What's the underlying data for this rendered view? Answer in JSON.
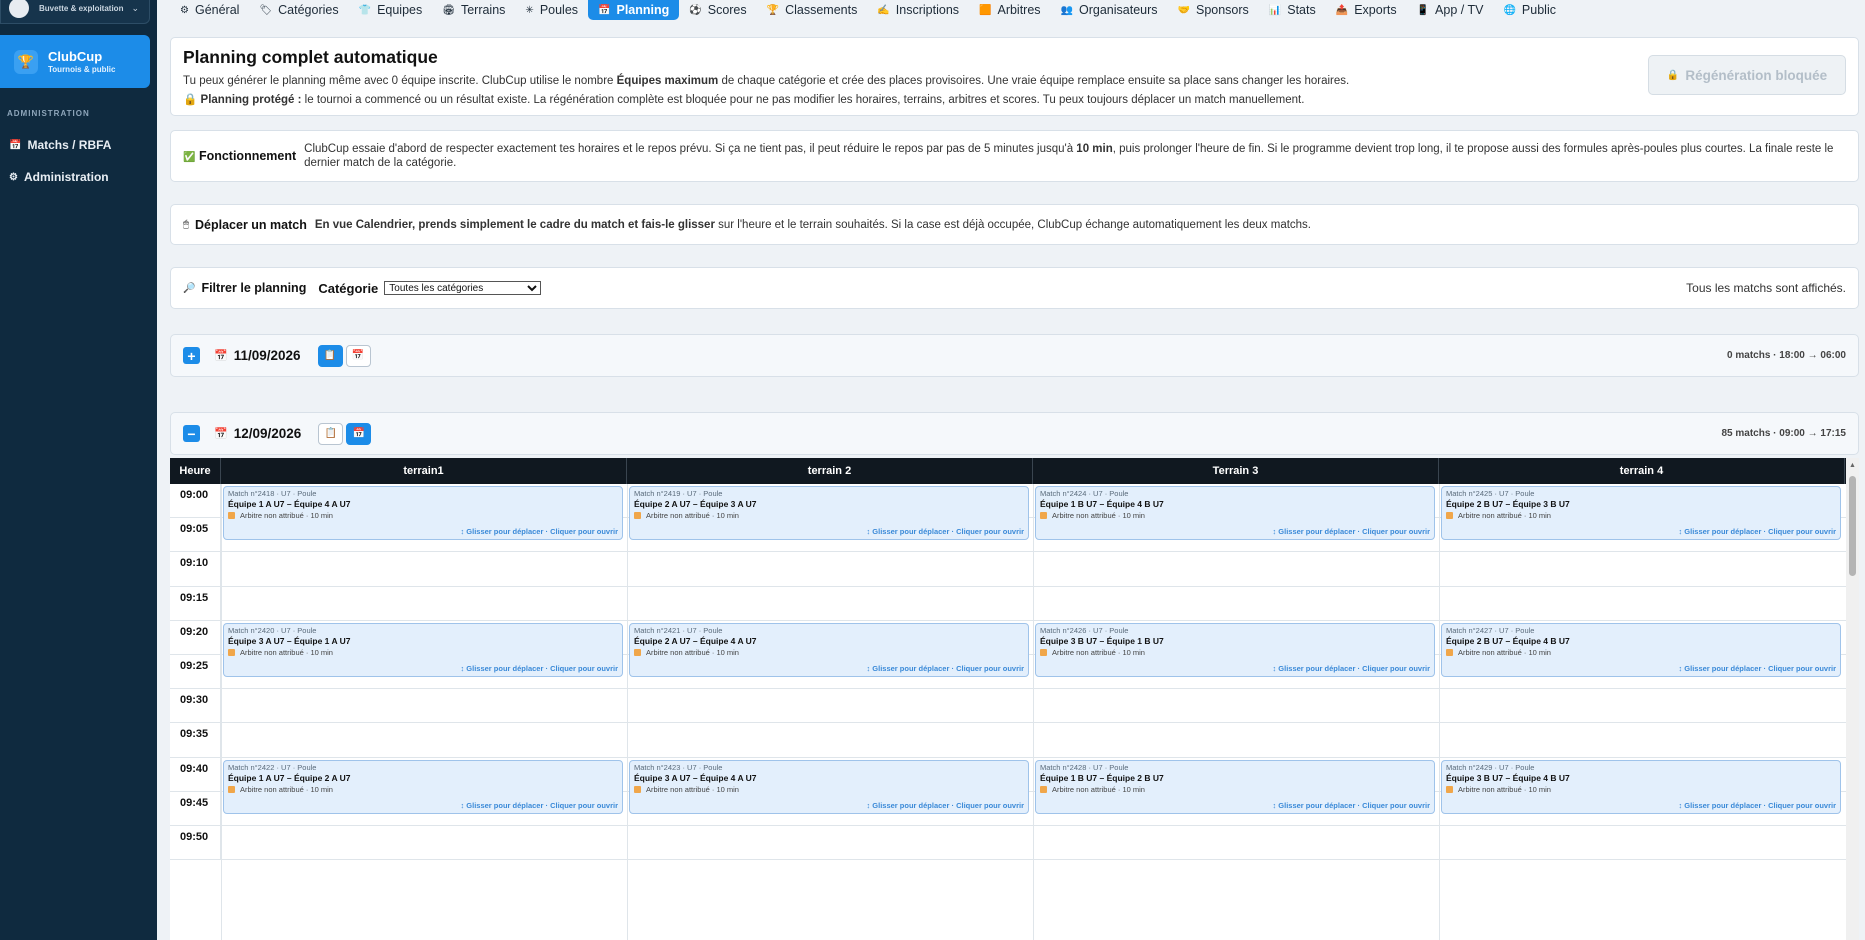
{
  "sidebar": {
    "top_label": "Buvette & exploitation",
    "brand_name": "ClubCup",
    "brand_sub": "Tournois & public",
    "section_label": "ADMINISTRATION",
    "items": [
      {
        "label": "Matchs / RBFA",
        "icon": "calendar-icon"
      },
      {
        "label": "Administration",
        "icon": "gear-icon"
      }
    ]
  },
  "nav": {
    "items": [
      {
        "label": "Général",
        "icon": "gear-icon"
      },
      {
        "label": "Catégories",
        "icon": "tag-icon"
      },
      {
        "label": "Equipes",
        "icon": "shirt-icon"
      },
      {
        "label": "Terrains",
        "icon": "stadium-icon"
      },
      {
        "label": "Poules",
        "icon": "cluster-icon"
      },
      {
        "label": "Planning",
        "icon": "calendar-icon"
      },
      {
        "label": "Scores",
        "icon": "ball-icon"
      },
      {
        "label": "Classements",
        "icon": "trophy-icon"
      },
      {
        "label": "Inscriptions",
        "icon": "pen-icon"
      },
      {
        "label": "Arbitres",
        "icon": "card-icon"
      },
      {
        "label": "Organisateurs",
        "icon": "people-icon"
      },
      {
        "label": "Sponsors",
        "icon": "handshake-icon"
      },
      {
        "label": "Stats",
        "icon": "chart-icon"
      },
      {
        "label": "Exports",
        "icon": "export-icon"
      },
      {
        "label": "App / TV",
        "icon": "phone-icon"
      },
      {
        "label": "Public",
        "icon": "globe-icon"
      }
    ],
    "active": "Planning"
  },
  "general": {
    "title": "Planning complet automatique",
    "line1_a": "Tu peux générer le planning même avec 0 équipe inscrite. ClubCup utilise le nombre ",
    "line1_b": "Équipes maximum",
    "line1_c": " de chaque catégorie et crée des places provisoires. Une vraie équipe remplace ensuite sa place sans changer les horaires.",
    "line2_a": "Planning protégé :",
    "line2_b": " le tournoi a commencé ou un résultat existe. La régénération complète est bloquée pour ne pas modifier les horaires, terrains, arbitres et scores. Tu peux toujours déplacer un match manuellement.",
    "regen_button": "Régénération bloquée"
  },
  "fonctionnement": {
    "label": "Fonctionnement",
    "text_a": "ClubCup essaie d'abord de respecter exactement tes horaires et le repos prévu. Si ça ne tient pas, il peut réduire le repos par pas de 5 minutes jusqu'à ",
    "text_b": "10 min",
    "text_c": ", puis prolonger l'heure de fin. Si le programme devient trop long, il te propose aussi des formules après-poules plus courtes. La finale reste le dernier match de la catégorie."
  },
  "deplacer": {
    "label": "Déplacer un match",
    "text_a": "En vue Calendrier, prends simplement le cadre du match et fais-le glisser",
    "text_b": " sur l'heure et le terrain souhaités. Si la case est déjà occupée, ClubCup échange automatiquement les deux matchs."
  },
  "filter": {
    "label": "Filtrer le planning",
    "category_label": "Catégorie",
    "category_value": "Toutes les catégories",
    "status": "Tous les matchs sont affichés."
  },
  "days": [
    {
      "date": "11/09/2026",
      "info": "0 matchs · 18:00 → 06:00",
      "expanded": false
    },
    {
      "date": "12/09/2026",
      "info": "85 matchs · 09:00 → 17:15",
      "expanded": true
    }
  ],
  "grid": {
    "time_header": "Heure",
    "terrains": [
      "terrain1",
      "terrain 2",
      "Terrain 3",
      "terrain 4"
    ],
    "times": [
      "09:00",
      "09:05",
      "09:10",
      "09:15",
      "09:20",
      "09:25",
      "09:30",
      "09:35",
      "09:40",
      "09:45",
      "09:50"
    ],
    "ref_text": "Arbitre non attribué · 10 min",
    "hint_text": "↕ Glisser pour déplacer · Cliquer pour ouvrir",
    "matches": [
      {
        "slot": 0,
        "col": 0,
        "meta": "Match n°2418 · U7 · Poule",
        "teams": "Équipe 1 A U7 – Équipe 4 A U7"
      },
      {
        "slot": 0,
        "col": 1,
        "meta": "Match n°2419 · U7 · Poule",
        "teams": "Équipe 2 A U7 – Équipe 3 A U7"
      },
      {
        "slot": 0,
        "col": 2,
        "meta": "Match n°2424 · U7 · Poule",
        "teams": "Équipe 1 B U7 – Équipe 4 B U7"
      },
      {
        "slot": 0,
        "col": 3,
        "meta": "Match n°2425 · U7 · Poule",
        "teams": "Équipe 2 B U7 – Équipe 3 B U7"
      },
      {
        "slot": 4,
        "col": 0,
        "meta": "Match n°2420 · U7 · Poule",
        "teams": "Équipe 3 A U7 – Équipe 1 A U7"
      },
      {
        "slot": 4,
        "col": 1,
        "meta": "Match n°2421 · U7 · Poule",
        "teams": "Équipe 2 A U7 – Équipe 4 A U7"
      },
      {
        "slot": 4,
        "col": 2,
        "meta": "Match n°2426 · U7 · Poule",
        "teams": "Équipe 3 B U7 – Équipe 1 B U7"
      },
      {
        "slot": 4,
        "col": 3,
        "meta": "Match n°2427 · U7 · Poule",
        "teams": "Équipe 2 B U7 – Équipe 4 B U7"
      },
      {
        "slot": 8,
        "col": 0,
        "meta": "Match n°2422 · U7 · Poule",
        "teams": "Équipe 1 A U7 – Équipe 2 A U7"
      },
      {
        "slot": 8,
        "col": 1,
        "meta": "Match n°2423 · U7 · Poule",
        "teams": "Équipe 3 A U7 – Équipe 4 A U7"
      },
      {
        "slot": 8,
        "col": 2,
        "meta": "Match n°2428 · U7 · Poule",
        "teams": "Équipe 1 B U7 – Équipe 2 B U7"
      },
      {
        "slot": 8,
        "col": 3,
        "meta": "Match n°2429 · U7 · Poule",
        "teams": "Équipe 3 B U7 – Équipe 4 B U7"
      }
    ]
  },
  "colors": {
    "sidebar_bg": "#0f2a3f",
    "accent": "#1c8ce8",
    "match_bg": "#e3effc",
    "grid_header_bg": "#101820"
  }
}
